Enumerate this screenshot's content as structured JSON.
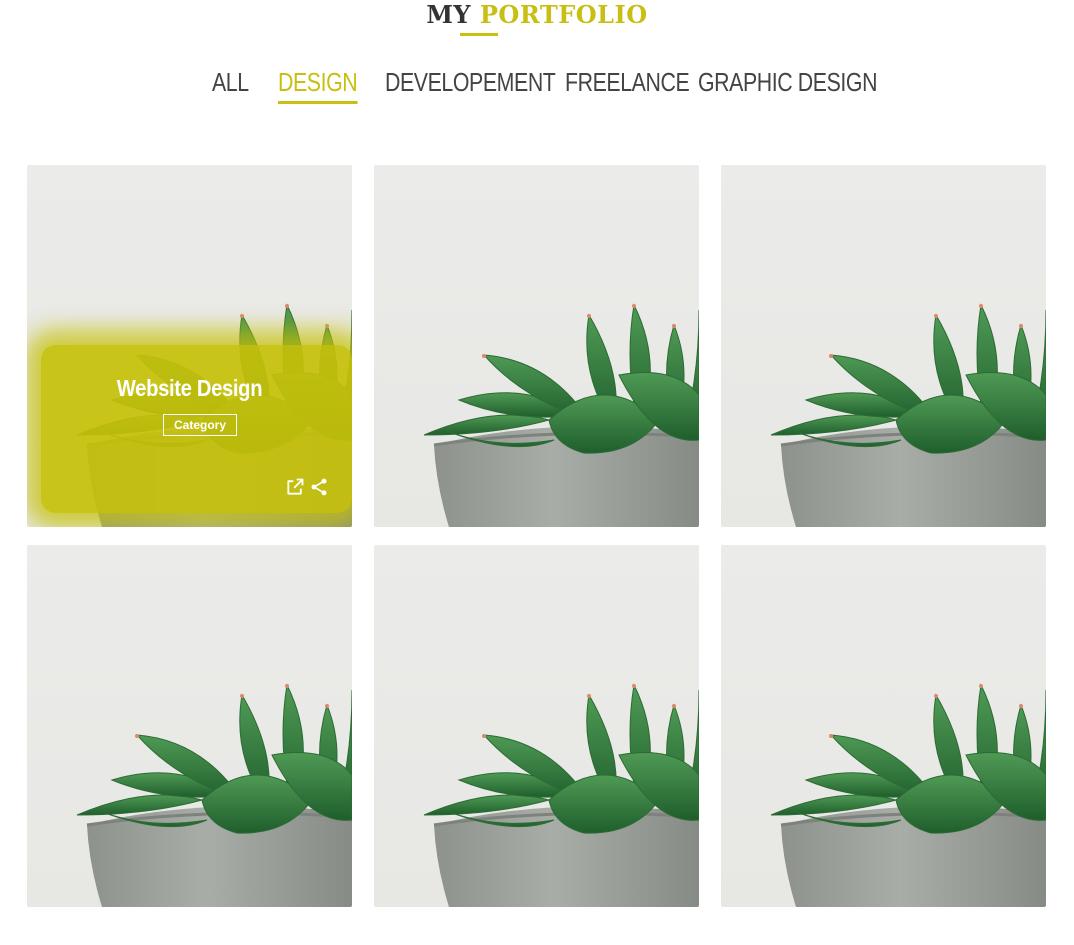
{
  "header": {
    "title_word1": "MY",
    "title_word2": "PORTFOLIO"
  },
  "colors": {
    "accent": "#c8bf12",
    "text": "#444444"
  },
  "filters": [
    {
      "label": "ALL",
      "active": false
    },
    {
      "label": "DESIGN",
      "active": true
    },
    {
      "label": "DEVELOPEMENT",
      "active": false
    },
    {
      "label": "FREELANCE",
      "active": false
    },
    {
      "label": "GRAPHIC DESIGN",
      "active": false
    }
  ],
  "portfolio": {
    "hovered_item": {
      "title": "Website Design",
      "category": "Category",
      "icons": [
        "external-link-icon",
        "share-icon"
      ]
    }
  }
}
